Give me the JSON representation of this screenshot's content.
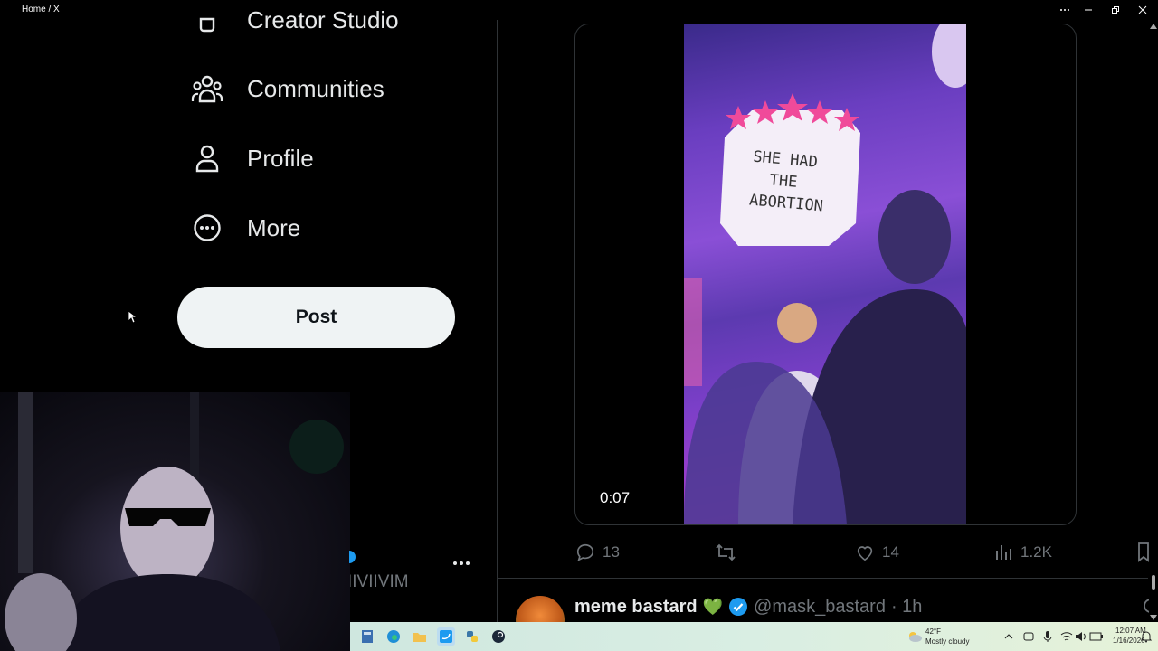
{
  "window": {
    "title": "Home / X"
  },
  "sidebar": {
    "items": [
      {
        "label": "Creator Studio",
        "icon": "creator-studio-icon"
      },
      {
        "label": "Communities",
        "icon": "communities-icon"
      },
      {
        "label": "Profile",
        "icon": "profile-icon"
      },
      {
        "label": "More",
        "icon": "more-circle-icon"
      }
    ],
    "post_label": "Post",
    "account_handle": "IIVIIVIM"
  },
  "tweet": {
    "video_duration": "0:07",
    "sign_text": "SHE HAD THE ABORTION",
    "replies": "13",
    "reposts": "",
    "likes": "14",
    "views": "1.2K"
  },
  "next_tweet": {
    "name": "meme bastard",
    "emoji": "💚",
    "handle": "@mask_bastard",
    "time": "· 1h"
  },
  "taskbar": {
    "weather_temp": "42°F",
    "weather_desc": "Mostly cloudy",
    "time": "12:07 AM",
    "date": "1/16/2026"
  },
  "colors": {
    "accent": "#1d9bf0",
    "text": "#e7e9ea",
    "muted": "#71767b",
    "border": "#2f3336"
  }
}
